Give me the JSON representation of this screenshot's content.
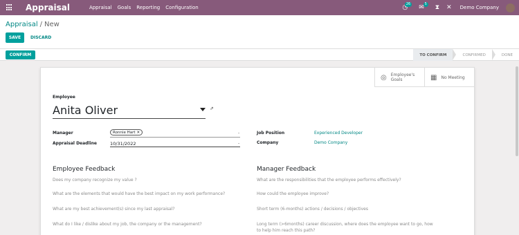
{
  "navbar": {
    "brand": "Appraisal",
    "menu": [
      "Appraisal",
      "Goals",
      "Reporting",
      "Configuration"
    ],
    "activity_badge": "26",
    "messages_badge": "5",
    "company": "Demo Company"
  },
  "breadcrumb": {
    "parent": "Appraisal",
    "separator": "/",
    "current": "New"
  },
  "toolbar": {
    "save_label": "SAVE",
    "discard_label": "DISCARD"
  },
  "statusbar": {
    "confirm_label": "CONFIRM",
    "stages": [
      "TO CONFIRM",
      "CONFIRMED",
      "DONE"
    ],
    "active_stage": "TO CONFIRM"
  },
  "smart_buttons": {
    "goals_line1": "Employee's",
    "goals_line2": "Goals",
    "meeting_label": "No Meeting"
  },
  "form": {
    "employee_label": "Employee",
    "employee_name": "Anita Oliver",
    "manager_label": "Manager",
    "manager_tag": "Ronnie Hart",
    "deadline_label": "Appraisal Deadline",
    "deadline_value": "10/31/2022",
    "job_label": "Job Position",
    "job_value": "Experienced Developer",
    "company_label": "Company",
    "company_value": "Demo Company",
    "dash": "-"
  },
  "employee_feedback": {
    "title": "Employee Feedback",
    "questions": [
      "Does my company recognize my value ?",
      "What are the elements that would have the best impact on my work performance?",
      "What are my best achievement(s) since my last appraisal?",
      "What do I like / dislike about my job, the company or the management?"
    ]
  },
  "manager_feedback": {
    "title": "Manager Feedback",
    "questions": [
      "What are the responsibilities that the employee performs effectively?",
      "How could the employee improve?",
      "Short term (6-months) actions / decisions / objectives",
      "Long term (>6months) career discussion, where does the employee want to go, how",
      "to help him reach this path?"
    ]
  }
}
